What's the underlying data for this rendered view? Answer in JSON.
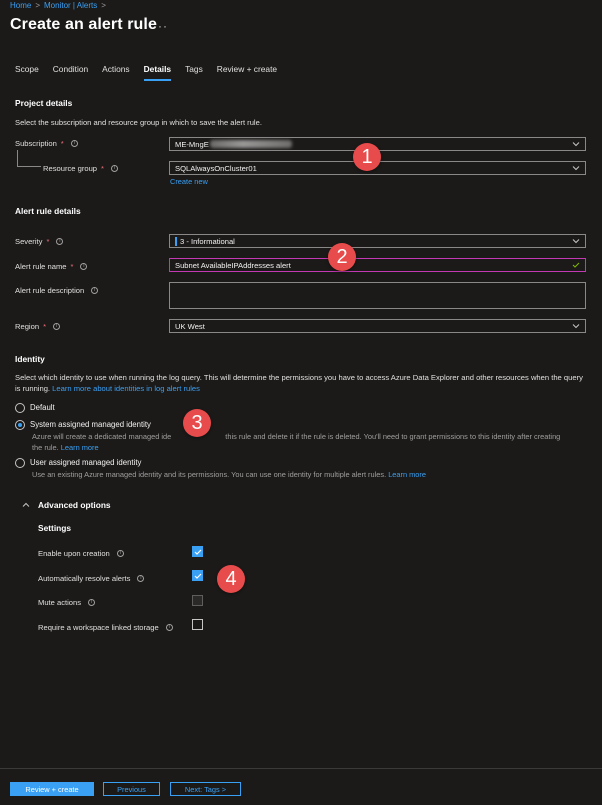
{
  "breadcrumb": {
    "home": "Home",
    "sep": ">",
    "current": "Monitor | Alerts",
    "sep2": ">"
  },
  "page": {
    "title": "Create an alert rule",
    "more": "···"
  },
  "tabs": [
    {
      "label": "Scope"
    },
    {
      "label": "Condition"
    },
    {
      "label": "Actions"
    },
    {
      "label": "Details"
    },
    {
      "label": "Tags"
    },
    {
      "label": "Review + create"
    }
  ],
  "project": {
    "title": "Project details",
    "description": "Select the subscription and resource group in which to save the alert rule.",
    "subscription_label": "Subscription",
    "subscription_value": "ME-MngE",
    "resource_group_label": "Resource group",
    "resource_group_value": "SQLAlwaysOnCluster01",
    "create_new": "Create new"
  },
  "alert": {
    "title": "Alert rule details",
    "severity_label": "Severity",
    "severity_value": "3 - Informational",
    "name_label": "Alert rule name",
    "name_value": "Subnet AvailableIPAddresses alert",
    "desc_label": "Alert rule description",
    "desc_value": "",
    "region_label": "Region",
    "region_value": "UK West"
  },
  "identity": {
    "title": "Identity",
    "description": "Select which identity to use when running the log query. This will determine the permissions you have to access Azure Data Explorer and other resources when the query is running.",
    "learn_more_link": "Learn more about identities in log alert rules",
    "default_label": "Default",
    "system_label": "System assigned managed identity",
    "system_desc_1": "Azure will create a dedicated managed ide",
    "system_desc_2": "this rule and delete it if the rule is deleted. You'll need to grant permissions to this identity after creating",
    "system_desc_3": "the rule.",
    "system_learn_more": "Learn more",
    "user_label": "User assigned managed identity",
    "user_desc": "Use an existing Azure managed identity and its permissions. You can use one identity for multiple alert rules.",
    "user_learn_more": "Learn more"
  },
  "advanced": {
    "title": "Advanced options",
    "settings_title": "Settings",
    "enable_label": "Enable upon creation",
    "resolve_label": "Automatically resolve alerts",
    "mute_label": "Mute actions",
    "workspace_label": "Require a workspace linked storage",
    "enable_checked": true,
    "resolve_checked": true,
    "mute_checked": false,
    "workspace_checked": false
  },
  "badges": [
    "1",
    "2",
    "3",
    "4"
  ],
  "footer": {
    "review_create": "Review + create",
    "previous": "Previous",
    "next": "Next: Tags >"
  },
  "colors": {
    "background": "#1b1a19",
    "accent": "#3aa0f3",
    "badge": "#e84b4b",
    "required": "#f1707b"
  }
}
